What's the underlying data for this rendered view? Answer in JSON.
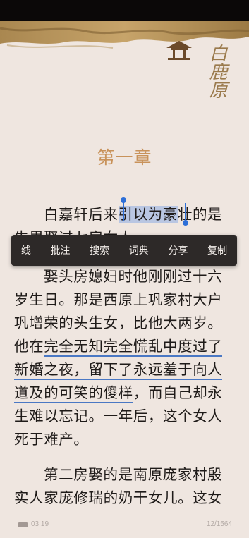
{
  "reader": {
    "chapter_title": "第一章",
    "title_calligraphy": "白鹿原",
    "lines": [
      {
        "pre": "白嘉轩后来",
        "sel": "引以为豪",
        "post": "壮的是"
      },
      {
        "text": "生里娶过七房女人。"
      },
      {
        "text": "娶头房媳妇时他刚刚过十六"
      },
      {
        "text": "岁生日。那是西原上巩家村大户"
      },
      {
        "text": "巩增荣的头生女，比他大两岁。"
      },
      {
        "pre": "他在",
        "ul": "完全无知完全慌乱中度过了"
      },
      {
        "ul": "新婚之夜，留下了永远羞于向人"
      },
      {
        "ul": "道及的可笑的傻样",
        "post": "，而自己却永"
      },
      {
        "text": "生难以忘记。一年后，这个女人"
      },
      {
        "text": "死于难产。"
      },
      {
        "text": "第二房娶的是南原庞家村殷"
      },
      {
        "text": "实人家庞修瑞的奶干女儿。这女"
      }
    ]
  },
  "context_menu": {
    "items": [
      "线",
      "批注",
      "搜索",
      "词典",
      "分享",
      "复制"
    ]
  },
  "footer": {
    "time": "03:19",
    "page": "12/1564"
  },
  "colors": {
    "background": "#efe6e0",
    "chapter_title": "#c8925a",
    "selection": "#b9c6e2",
    "underline": "#4a78c4",
    "menu_bg": "#2d2928"
  }
}
